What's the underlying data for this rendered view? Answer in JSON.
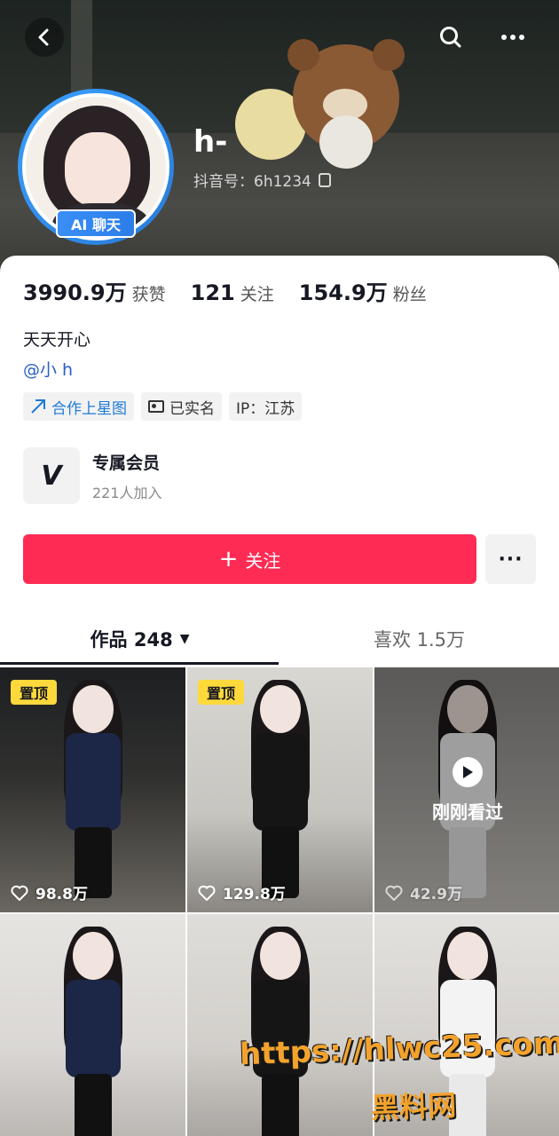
{
  "header": {
    "nickname": "h-",
    "douyin_id": "抖音号：6h1234",
    "ai_badge": "AI 聊天"
  },
  "stats": [
    {
      "num": "3990.9万",
      "label": "获赞"
    },
    {
      "num": "121",
      "label": "关注"
    },
    {
      "num": "154.9万",
      "label": "粉丝"
    }
  ],
  "bio": "天天开心",
  "mention": "@小 h",
  "tags": [
    {
      "label": "合作上星图",
      "icon": "star-map-icon"
    },
    {
      "label": "已实名",
      "icon": "id-card-icon"
    },
    {
      "label": "IP：江苏",
      "icon": ""
    }
  ],
  "member": {
    "logo": "V",
    "title": "专属会员",
    "subtitle": "221人加入"
  },
  "follow": {
    "label": "关注",
    "plus": "+"
  },
  "more_label": "···",
  "tabs": [
    {
      "label": "作品 248",
      "active": true
    },
    {
      "label": "喜欢 1.5万",
      "active": false
    }
  ],
  "videos": [
    {
      "pinned": "置顶",
      "likes": "98.8万"
    },
    {
      "pinned": "置顶",
      "likes": "129.8万"
    },
    {
      "recent": "刚刚看过",
      "likes": "42.9万"
    },
    {
      "likes": ""
    },
    {
      "likes": ""
    },
    {
      "likes": ""
    }
  ],
  "watermark": {
    "url": "https://hlwc25.com",
    "name": "黑料网"
  },
  "colors": {
    "accent": "#fe2c55",
    "link": "#2a5dc8",
    "pin_badge": "#ffd93b",
    "ai_badge": "#3a8ef6"
  }
}
